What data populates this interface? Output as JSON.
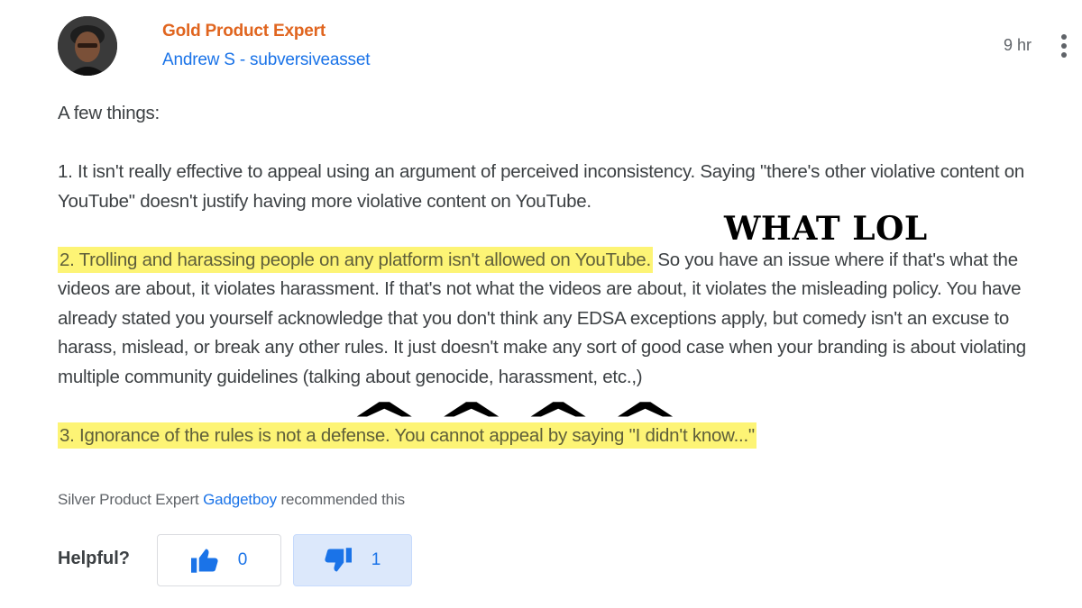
{
  "author": {
    "badge": "Gold Product Expert",
    "name": "Andrew S - subversiveasset",
    "time": "9 hr",
    "avatar_icon": "user-avatar-photo"
  },
  "post": {
    "intro": "A few things:",
    "point1": "1. It isn't really effective to appeal using an argument of perceived inconsistency. Saying \"there's other violative content on YouTube\" doesn't justify having more violative content on YouTube.",
    "point2_highlight": "2. Trolling and harassing people on any platform isn't allowed on YouTube.",
    "point2_rest": " So you have an issue where if that's what the videos are about, it violates harassment. If that's not what the videos are about, it violates the misleading policy. You have already stated you yourself acknowledge that you don't think any EDSA exceptions apply, but comedy isn't an excuse to harass, mislead, or break any other rules. It just doesn't make any sort of good case when your branding is about violating multiple community guidelines (talking about genocide, harassment, etc.,)",
    "point3_highlight": "3. Ignorance of the rules is not a defense. You cannot appeal by saying \"I didn't know...\""
  },
  "annotations": {
    "what_lol": "WHAT LOL",
    "carets": "^^^^"
  },
  "recommendation": {
    "prefix": "Silver Product Expert ",
    "name": "Gadgetboy",
    "suffix": " recommended this"
  },
  "helpful": {
    "label": "Helpful?",
    "up_count": "0",
    "down_count": "1",
    "up_icon": "thumbs-up-icon",
    "down_icon": "thumbs-down-icon"
  },
  "colors": {
    "badge": "#e0651f",
    "link": "#1a73e8",
    "highlight": "#fdf475",
    "selected_vote_bg": "#dce8fb"
  }
}
